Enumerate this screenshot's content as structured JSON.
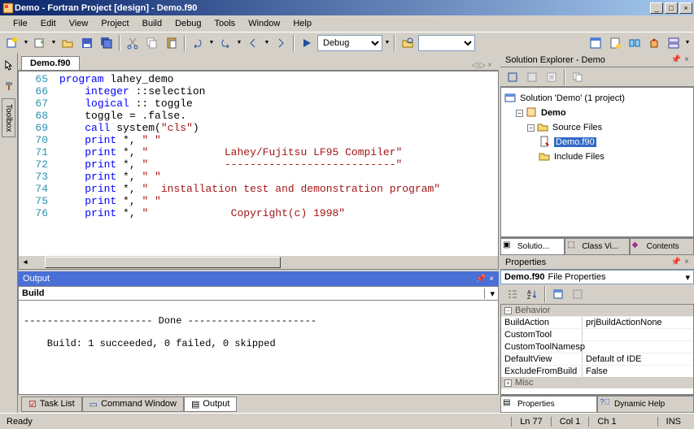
{
  "title": "Demo - Fortran Project [design] - Demo.f90",
  "menu": [
    "File",
    "Edit",
    "View",
    "Project",
    "Build",
    "Debug",
    "Tools",
    "Window",
    "Help"
  ],
  "toolbar": {
    "config": "Debug"
  },
  "editor": {
    "tab": "Demo.f90",
    "lines": [
      {
        "n": 65,
        "pre": "",
        "kw": "program",
        "rest": " lahey_demo"
      },
      {
        "n": 66,
        "pre": "    ",
        "kw": "integer",
        "rest": " ::selection"
      },
      {
        "n": 67,
        "pre": "    ",
        "kw": "logical",
        "rest": " :: toggle"
      },
      {
        "n": 68,
        "pre": "    ",
        "plain": "toggle = .false."
      },
      {
        "n": 69,
        "pre": "    ",
        "kw": "call",
        "rest": " system(",
        "str": "\"cls\"",
        "tail": ")"
      },
      {
        "n": 70,
        "pre": "    ",
        "kw": "print",
        "rest": " *, ",
        "str": "\" \""
      },
      {
        "n": 71,
        "pre": "    ",
        "kw": "print",
        "rest": " *, ",
        "str": "\"            Lahey/Fujitsu LF95 Compiler\""
      },
      {
        "n": 72,
        "pre": "    ",
        "kw": "print",
        "rest": " *, ",
        "str": "\"            ---------------------------\""
      },
      {
        "n": 73,
        "pre": "    ",
        "kw": "print",
        "rest": " *, ",
        "str": "\" \""
      },
      {
        "n": 74,
        "pre": "    ",
        "kw": "print",
        "rest": " *, ",
        "str": "\"  installation test and demonstration program\""
      },
      {
        "n": 75,
        "pre": "    ",
        "kw": "print",
        "rest": " *, ",
        "str": "\" \""
      },
      {
        "n": 76,
        "pre": "    ",
        "kw": "print",
        "rest": " *, ",
        "str": "\"             Copyright(c) 1998\""
      }
    ]
  },
  "output": {
    "title": "Output",
    "category": "Build",
    "text": "\n---------------------- Done ----------------------\n\n    Build: 1 succeeded, 0 failed, 0 skipped\n\n\n"
  },
  "bottomTabs": {
    "task": "Task List",
    "cmd": "Command Window",
    "out": "Output"
  },
  "explorer": {
    "title": "Solution Explorer - Demo",
    "solution": "Solution 'Demo' (1 project)",
    "project": "Demo",
    "folders": {
      "src": "Source Files",
      "inc": "Include Files"
    },
    "file": "Demo.f90",
    "tabs": {
      "sol": "Solutio...",
      "cls": "Class Vi...",
      "con": "Contents"
    }
  },
  "properties": {
    "title": "Properties",
    "objName": "Demo.f90",
    "objType": "File Properties",
    "catBehavior": "Behavior",
    "catMisc": "Misc",
    "rows": [
      {
        "k": "BuildAction",
        "v": "prjBuildActionNone"
      },
      {
        "k": "CustomTool",
        "v": ""
      },
      {
        "k": "CustomToolNamesp",
        "v": ""
      },
      {
        "k": "DefaultView",
        "v": "Default of IDE"
      },
      {
        "k": "ExcludeFromBuild",
        "v": "False"
      }
    ],
    "tabs": {
      "props": "Properties",
      "help": "Dynamic Help"
    }
  },
  "sidebar": {
    "toolbox": "Toolbox"
  },
  "status": {
    "ready": "Ready",
    "ln": "Ln 77",
    "ch": "Ch 1",
    "ins": "INS",
    "col": "Col 1"
  }
}
